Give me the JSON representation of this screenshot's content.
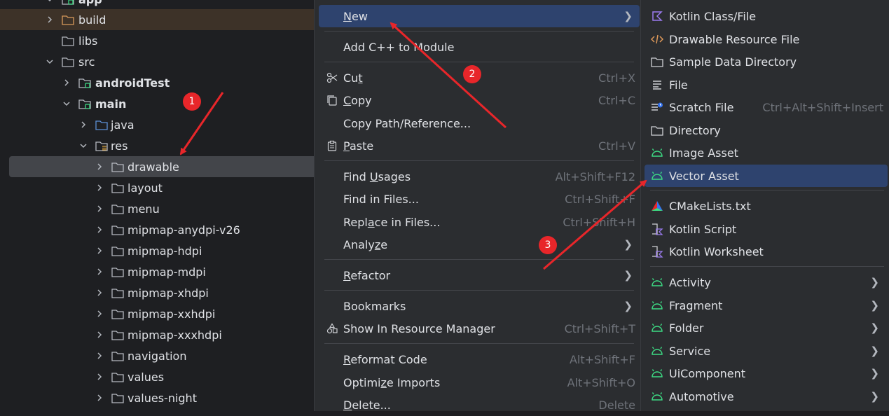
{
  "tree": {
    "items": [
      {
        "label": "app"
      },
      {
        "label": "build"
      },
      {
        "label": "libs"
      },
      {
        "label": "src"
      },
      {
        "label": "androidTest"
      },
      {
        "label": "main"
      },
      {
        "label": "java"
      },
      {
        "label": "res"
      },
      {
        "label": "drawable"
      },
      {
        "label": "layout"
      },
      {
        "label": "menu"
      },
      {
        "label": "mipmap-anydpi-v26"
      },
      {
        "label": "mipmap-hdpi"
      },
      {
        "label": "mipmap-mdpi"
      },
      {
        "label": "mipmap-xhdpi"
      },
      {
        "label": "mipmap-xxhdpi"
      },
      {
        "label": "mipmap-xxxhdpi"
      },
      {
        "label": "navigation"
      },
      {
        "label": "values"
      },
      {
        "label": "values-night"
      }
    ]
  },
  "context_menu": {
    "new": {
      "pre": "",
      "u": "N",
      "post": "ew"
    },
    "add_cpp": {
      "label": "Add C++ to Module"
    },
    "cut": {
      "pre": "Cu",
      "u": "t",
      "post": "",
      "key": "Ctrl+X"
    },
    "copy": {
      "pre": "",
      "u": "C",
      "post": "opy",
      "key": "Ctrl+C"
    },
    "copy_path": {
      "label": "Copy Path/Reference..."
    },
    "paste": {
      "pre": "",
      "u": "P",
      "post": "aste",
      "key": "Ctrl+V"
    },
    "find_usages": {
      "pre": "Find ",
      "u": "U",
      "post": "sages",
      "key": "Alt+Shift+F12"
    },
    "find_in_files": {
      "label": "Find in Files...",
      "key": "Ctrl+Shift+F"
    },
    "replace_in_files": {
      "pre": "Repl",
      "u": "a",
      "post": "ce in Files...",
      "key": "Ctrl+Shift+H"
    },
    "analyze": {
      "pre": "Analy",
      "u": "z",
      "post": "e"
    },
    "refactor": {
      "pre": "",
      "u": "R",
      "post": "efactor"
    },
    "bookmarks": {
      "label": "Bookmarks"
    },
    "show_in_resource_manager": {
      "label": "Show In Resource Manager",
      "key": "Ctrl+Shift+T"
    },
    "reformat_code": {
      "pre": "",
      "u": "R",
      "post": "eformat Code",
      "key": "Alt+Shift+F"
    },
    "optimize_imports": {
      "pre": "Optimi",
      "u": "z",
      "post": "e Imports",
      "key": "Alt+Shift+O"
    },
    "delete": {
      "pre": "",
      "u": "D",
      "post": "elete...",
      "key": "Delete"
    }
  },
  "submenu": {
    "items": [
      {
        "label": "Kotlin Class/File",
        "icon": "kotlin-icon"
      },
      {
        "label": "Drawable Resource File",
        "icon": "xml-code-icon"
      },
      {
        "label": "Sample Data Directory",
        "icon": "folder-icon"
      },
      {
        "label": "File",
        "icon": "text-file-icon"
      },
      {
        "label": "Scratch File",
        "icon": "scratch-file-icon",
        "key": "Ctrl+Alt+Shift+Insert"
      },
      {
        "label": "Directory",
        "icon": "folder-icon"
      },
      {
        "label": "Image Asset",
        "icon": "android-icon"
      },
      {
        "label": "Vector Asset",
        "icon": "android-icon"
      },
      {
        "label": "CMakeLists.txt",
        "icon": "cmake-icon"
      },
      {
        "label": "Kotlin Script",
        "icon": "kotlin-script-icon"
      },
      {
        "label": "Kotlin Worksheet",
        "icon": "kotlin-script-icon"
      },
      {
        "label": "Activity",
        "icon": "android-icon"
      },
      {
        "label": "Fragment",
        "icon": "android-icon"
      },
      {
        "label": "Folder",
        "icon": "android-icon"
      },
      {
        "label": "Service",
        "icon": "android-icon"
      },
      {
        "label": "UiComponent",
        "icon": "android-icon"
      },
      {
        "label": "Automotive",
        "icon": "android-icon"
      }
    ]
  },
  "annotations": {
    "badges": [
      "1",
      "2",
      "3"
    ],
    "color": "#e8262a"
  },
  "colors": {
    "background": "#1e1f22",
    "menu_background": "#2b2d30",
    "selection": "#2e436e",
    "tree_selection": "#43454a",
    "android_green": "#3ddc84"
  }
}
